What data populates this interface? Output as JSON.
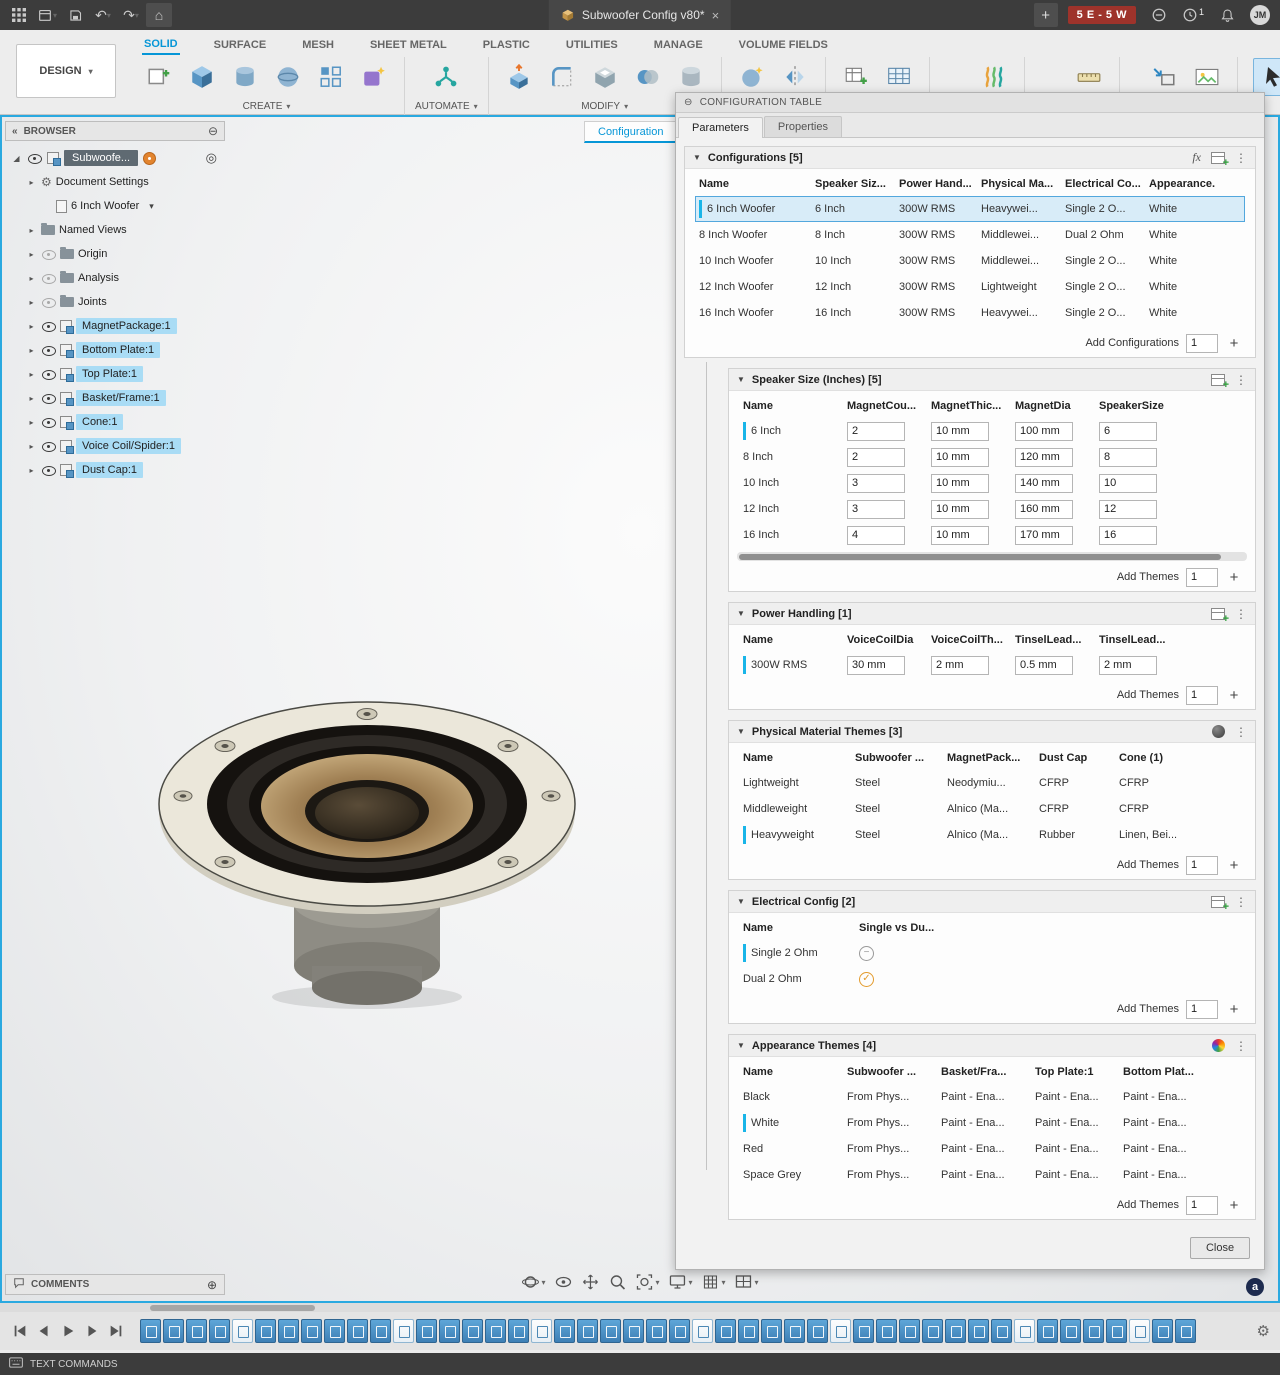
{
  "titlebar": {
    "title": "Subwoofer Config v80*",
    "badge": "5 E - 5 W",
    "clock_count": "1",
    "avatar": "JM",
    "left_icons": [
      "app-grid-icon",
      "file-menu-icon",
      "save-icon",
      "undo-icon",
      "redo-icon",
      "home-icon"
    ],
    "right_icons": [
      "new-tab-icon",
      "extensions-icon",
      "clock-icon",
      "bell-icon"
    ]
  },
  "ribbon": {
    "workspace_label": "DESIGN",
    "tabs": [
      {
        "label": "SOLID",
        "active": true
      },
      {
        "label": "SURFACE"
      },
      {
        "label": "MESH"
      },
      {
        "label": "SHEET METAL"
      },
      {
        "label": "PLASTIC"
      },
      {
        "label": "UTILITIES"
      },
      {
        "label": "MANAGE"
      },
      {
        "label": "VOLUME FIELDS"
      }
    ],
    "group_labels": {
      "create": "CREATE",
      "automate": "AUTOMATE",
      "modify": "MODIFY"
    }
  },
  "browser": {
    "header": "BROWSER",
    "root_label": "Subwoofe...",
    "items": [
      {
        "label": "Document Settings",
        "icon": "gear",
        "expander": true,
        "indent": 1
      },
      {
        "label": "6 Inch Woofer",
        "icon": "units",
        "indent": 2,
        "chevron": true
      },
      {
        "label": "Named Views",
        "icon": "folder",
        "expander": true,
        "indent": 1
      },
      {
        "label": "Origin",
        "icon": "folder",
        "expander": true,
        "indent": 1,
        "eye": "dim"
      },
      {
        "label": "Analysis",
        "icon": "folder",
        "expander": true,
        "indent": 1,
        "eye": "dim"
      },
      {
        "label": "Joints",
        "icon": "folder",
        "expander": true,
        "indent": 1,
        "eye": "dim"
      },
      {
        "label": "MagnetPackage:1",
        "icon": "component",
        "expander": true,
        "indent": 1,
        "eye": "on",
        "highlight": true
      },
      {
        "label": "Bottom Plate:1",
        "icon": "component",
        "expander": true,
        "indent": 1,
        "eye": "on",
        "highlight": true
      },
      {
        "label": "Top Plate:1",
        "icon": "component",
        "expander": true,
        "indent": 1,
        "eye": "on",
        "highlight": true
      },
      {
        "label": "Basket/Frame:1",
        "icon": "component",
        "expander": true,
        "indent": 1,
        "eye": "on",
        "highlight": true
      },
      {
        "label": "Cone:1",
        "icon": "component",
        "expander": true,
        "indent": 1,
        "eye": "on",
        "highlight": true
      },
      {
        "label": "Voice Coil/Spider:1",
        "icon": "component",
        "expander": true,
        "indent": 1,
        "eye": "on",
        "highlight": true
      },
      {
        "label": "Dust Cap:1",
        "icon": "component",
        "expander": true,
        "indent": 1,
        "eye": "on",
        "highlight": true
      }
    ]
  },
  "canvas": {
    "config_tab_label": "Configuration",
    "assistant_label": "a"
  },
  "config_panel": {
    "header": "CONFIGURATION TABLE",
    "tabs": [
      {
        "label": "Parameters",
        "active": true
      },
      {
        "label": "Properties"
      }
    ],
    "close_label": "Close",
    "sections": [
      {
        "title": "Configurations [5]",
        "nested": false,
        "header_icons": [
          "fx-icon",
          "add-column-icon",
          "overflow-menu-icon"
        ],
        "cell_type": "text",
        "columns": [
          "Name",
          "Speaker Siz...",
          "Power Hand...",
          "Physical Ma...",
          "Electrical Co...",
          "Appearance..."
        ],
        "rows": [
          {
            "name": "6 Inch Woofer",
            "marker": true,
            "selected": true,
            "cells": [
              "6 Inch",
              "300W RMS",
              "Heavywei...",
              "Single 2 O...",
              "White"
            ]
          },
          {
            "name": "8 Inch Woofer",
            "cells": [
              "8 Inch",
              "300W RMS",
              "Middlewei...",
              "Dual 2 Ohm",
              "White"
            ]
          },
          {
            "name": "10 Inch Woofer",
            "cells": [
              "10 Inch",
              "300W RMS",
              "Middlewei...",
              "Single 2 O...",
              "White"
            ]
          },
          {
            "name": "12 Inch Woofer",
            "cells": [
              "12 Inch",
              "300W RMS",
              "Lightweight",
              "Single 2 O...",
              "White"
            ]
          },
          {
            "name": "16 Inch Woofer",
            "cells": [
              "16 Inch",
              "300W RMS",
              "Heavywei...",
              "Single 2 O...",
              "White"
            ]
          }
        ],
        "footer_label": "Add Configurations",
        "footer_value": "1"
      },
      {
        "title": "Speaker Size (Inches) [5]",
        "nested": true,
        "header_icons": [
          "add-column-icon",
          "overflow-menu-icon"
        ],
        "cell_type": "input",
        "columns": [
          "Name",
          "MagnetCou...",
          "MagnetThic...",
          "MagnetDia",
          "SpeakerSize"
        ],
        "rows": [
          {
            "name": "6 Inch",
            "marker": true,
            "cells": [
              "2",
              "10 mm",
              "100 mm",
              "6"
            ]
          },
          {
            "name": "8 Inch",
            "cells": [
              "2",
              "10 mm",
              "120 mm",
              "8"
            ]
          },
          {
            "name": "10 Inch",
            "cells": [
              "3",
              "10 mm",
              "140 mm",
              "10"
            ]
          },
          {
            "name": "12 Inch",
            "cells": [
              "3",
              "10 mm",
              "160 mm",
              "12"
            ]
          },
          {
            "name": "16 Inch",
            "cells": [
              "4",
              "10 mm",
              "170 mm",
              "16"
            ]
          }
        ],
        "footer_label": "Add Themes",
        "footer_value": "1",
        "hscrollbar": true
      },
      {
        "title": "Power Handling [1]",
        "nested": true,
        "header_icons": [
          "add-column-icon",
          "overflow-menu-icon"
        ],
        "cell_type": "input",
        "columns": [
          "Name",
          "VoiceCoilDia",
          "VoiceCoilTh...",
          "TinselLead...",
          "TinselLead..."
        ],
        "rows": [
          {
            "name": "300W RMS",
            "marker": true,
            "cells": [
              "30 mm",
              "2 mm",
              "0.5 mm",
              "2 mm"
            ]
          }
        ],
        "footer_label": "Add Themes",
        "footer_value": "1"
      },
      {
        "title": "Physical Material Themes [3]",
        "nested": true,
        "header_icons": [
          "material-sphere-icon",
          "overflow-menu-icon"
        ],
        "cell_type": "text",
        "columns": [
          "Name",
          "Subwoofer ...",
          "MagnetPack...",
          "Dust Cap",
          "Cone (1)"
        ],
        "rows": [
          {
            "name": "Lightweight",
            "cells": [
              "Steel",
              "Neodymiu...",
              "CFRP",
              "CFRP"
            ]
          },
          {
            "name": "Middleweight",
            "cells": [
              "Steel",
              "Alnico (Ma...",
              "CFRP",
              "CFRP"
            ]
          },
          {
            "name": "Heavyweight",
            "marker": true,
            "cells": [
              "Steel",
              "Alnico (Ma...",
              "Rubber",
              "Linen, Bei..."
            ]
          }
        ],
        "footer_label": "Add Themes",
        "footer_value": "1"
      },
      {
        "title": "Electrical Config [2]",
        "nested": true,
        "header_icons": [
          "add-column-icon",
          "overflow-menu-icon"
        ],
        "cell_type": "icon",
        "columns": [
          "Name",
          "Single vs Du..."
        ],
        "rows": [
          {
            "name": "Single 2 Ohm",
            "marker": true,
            "cells": [
              "minus-circle"
            ]
          },
          {
            "name": "Dual 2 Ohm",
            "cells": [
              "check-circle"
            ]
          }
        ],
        "footer_label": "Add Themes",
        "footer_value": "1"
      },
      {
        "title": "Appearance Themes [4]",
        "nested": true,
        "header_icons": [
          "color-wheel-icon",
          "overflow-menu-icon"
        ],
        "cell_type": "text",
        "columns": [
          "Name",
          "Subwoofer ...",
          "Basket/Fra...",
          "Top Plate:1",
          "Bottom Plat..."
        ],
        "rows": [
          {
            "name": "Black",
            "cells": [
              "From Phys...",
              "Paint - Ena...",
              "Paint - Ena...",
              "Paint - Ena..."
            ]
          },
          {
            "name": "White",
            "marker": true,
            "cells": [
              "From Phys...",
              "Paint - Ena...",
              "Paint - Ena...",
              "Paint - Ena..."
            ]
          },
          {
            "name": "Red",
            "cells": [
              "From Phys...",
              "Paint - Ena...",
              "Paint - Ena...",
              "Paint - Ena..."
            ]
          },
          {
            "name": "Space Grey",
            "cells": [
              "From Phys...",
              "Paint - Ena...",
              "Paint - Ena...",
              "Paint - Ena..."
            ]
          }
        ],
        "footer_label": "Add Themes",
        "footer_value": "1"
      }
    ]
  },
  "nav": {
    "tools": [
      "orbit",
      "look-at",
      "pan",
      "zoom",
      "fit",
      "display-settings",
      "grid-settings",
      "viewports"
    ]
  },
  "comments": {
    "label": "COMMENTS"
  },
  "timeline": {
    "feature_count": 46,
    "playback": [
      "skip-start",
      "step-back",
      "play",
      "step-forward",
      "skip-end"
    ]
  },
  "statusbar": {
    "label": "TEXT COMMANDS"
  }
}
